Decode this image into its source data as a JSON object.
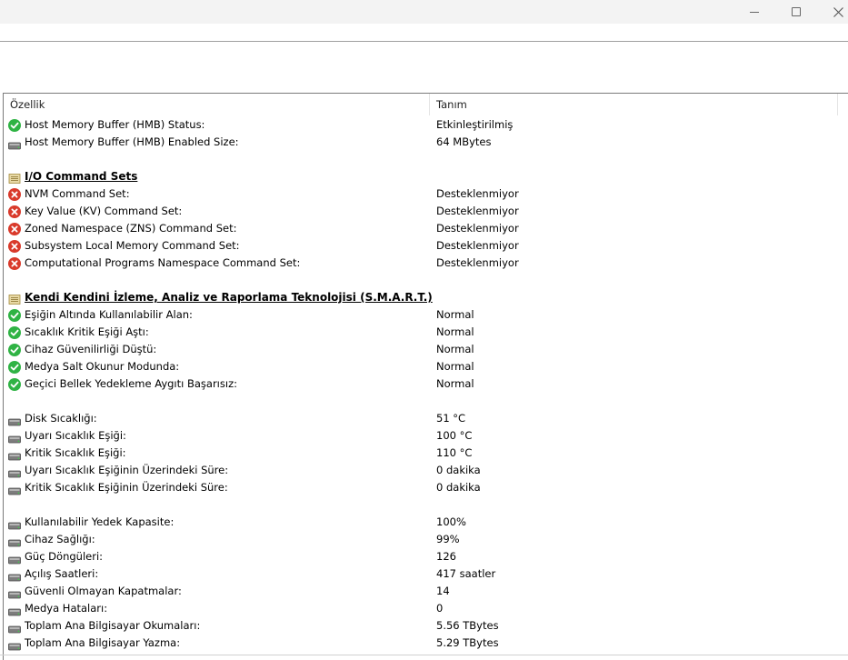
{
  "window": {
    "controls": [
      "minimize",
      "maximize",
      "close"
    ]
  },
  "columns": {
    "property": "Özellik",
    "description": "Tanım"
  },
  "rows": [
    {
      "kind": "item",
      "icon": "check-icon",
      "name": "Host Memory Buffer (HMB) Status:",
      "value": "Etkinleştirilmiş"
    },
    {
      "kind": "item",
      "icon": "disk-icon",
      "name": "Host Memory Buffer (HMB) Enabled Size:",
      "value": "64 MBytes"
    },
    {
      "kind": "blank"
    },
    {
      "kind": "section",
      "icon": "section-icon",
      "name": "I/O Command Sets"
    },
    {
      "kind": "item",
      "icon": "error-icon",
      "name": "NVM Command Set:",
      "value": "Desteklenmiyor"
    },
    {
      "kind": "item",
      "icon": "error-icon",
      "name": "Key Value (KV) Command Set:",
      "value": "Desteklenmiyor"
    },
    {
      "kind": "item",
      "icon": "error-icon",
      "name": "Zoned Namespace (ZNS) Command Set:",
      "value": "Desteklenmiyor"
    },
    {
      "kind": "item",
      "icon": "error-icon",
      "name": "Subsystem Local Memory Command Set:",
      "value": "Desteklenmiyor"
    },
    {
      "kind": "item",
      "icon": "error-icon",
      "name": "Computational Programs Namespace Command Set:",
      "value": "Desteklenmiyor"
    },
    {
      "kind": "blank"
    },
    {
      "kind": "section",
      "icon": "section-icon",
      "name": "Kendi Kendini İzleme, Analiz ve Raporlama Teknolojisi (S.M.A.R.T.)"
    },
    {
      "kind": "item",
      "icon": "check-icon",
      "name": "Eşiğin Altında Kullanılabilir Alan:",
      "value": "Normal"
    },
    {
      "kind": "item",
      "icon": "check-icon",
      "name": "Sıcaklık Kritik Eşiği Aştı:",
      "value": "Normal"
    },
    {
      "kind": "item",
      "icon": "check-icon",
      "name": "Cihaz Güvenilirliği Düştü:",
      "value": "Normal"
    },
    {
      "kind": "item",
      "icon": "check-icon",
      "name": "Medya Salt Okunur Modunda:",
      "value": "Normal"
    },
    {
      "kind": "item",
      "icon": "check-icon",
      "name": "Geçici Bellek Yedekleme Aygıtı Başarısız:",
      "value": "Normal"
    },
    {
      "kind": "blank"
    },
    {
      "kind": "item",
      "icon": "disk-icon",
      "name": "Disk Sıcaklığı:",
      "value": "51 °C"
    },
    {
      "kind": "item",
      "icon": "disk-icon",
      "name": "Uyarı Sıcaklık Eşiği:",
      "value": "100 °C"
    },
    {
      "kind": "item",
      "icon": "disk-icon",
      "name": "Kritik Sıcaklık Eşiği:",
      "value": "110 °C"
    },
    {
      "kind": "item",
      "icon": "disk-icon",
      "name": "Uyarı Sıcaklık Eşiğinin Üzerindeki Süre:",
      "value": "0 dakika"
    },
    {
      "kind": "item",
      "icon": "disk-icon",
      "name": "Kritik Sıcaklık Eşiğinin Üzerindeki Süre:",
      "value": "0 dakika"
    },
    {
      "kind": "blank"
    },
    {
      "kind": "item",
      "icon": "disk-icon",
      "name": "Kullanılabilir Yedek Kapasite:",
      "value": "100%"
    },
    {
      "kind": "item",
      "icon": "disk-icon",
      "name": "Cihaz Sağlığı:",
      "value": "99%"
    },
    {
      "kind": "item",
      "icon": "disk-icon",
      "name": "Güç Döngüleri:",
      "value": "126"
    },
    {
      "kind": "item",
      "icon": "disk-icon",
      "name": "Açılış Saatleri:",
      "value": "417 saatler"
    },
    {
      "kind": "item",
      "icon": "disk-icon",
      "name": "Güvenli Olmayan Kapatmalar:",
      "value": "14"
    },
    {
      "kind": "item",
      "icon": "disk-icon",
      "name": "Medya Hataları:",
      "value": "0"
    },
    {
      "kind": "item",
      "icon": "disk-icon",
      "name": "Toplam Ana Bilgisayar Okumaları:",
      "value": "5.56 TBytes"
    },
    {
      "kind": "item",
      "icon": "disk-icon",
      "name": "Toplam Ana Bilgisayar Yazma:",
      "value": "5.29 TBytes"
    }
  ]
}
